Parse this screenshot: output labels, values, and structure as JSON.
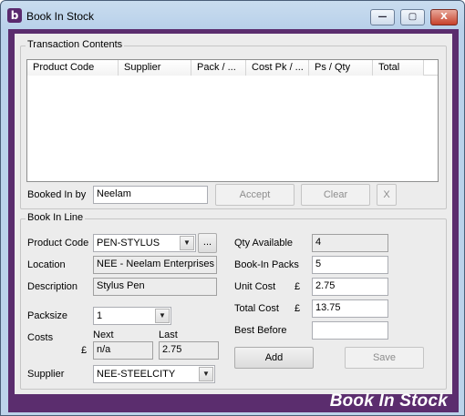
{
  "window": {
    "app_icon": "b",
    "title": "Book In Stock",
    "minimize_glyph": "—",
    "maximize_glyph": "▢",
    "close_glyph": "X"
  },
  "transaction": {
    "group_title": "Transaction Contents",
    "columns": [
      "Product Code",
      "Supplier",
      "Pack / ...",
      "Cost Pk / ...",
      "Ps / Qty",
      "Total"
    ],
    "booked_in_by_label": "Booked In by",
    "booked_in_by_value": "Neelam",
    "accept_label": "Accept",
    "clear_label": "Clear",
    "x_label": "X"
  },
  "bookin": {
    "group_title": "Book In Line",
    "product_code_label": "Product Code",
    "product_code_value": "PEN-STYLUS",
    "browse_label": "...",
    "location_label": "Location",
    "location_value": "NEE - Neelam Enterprises",
    "description_label": "Description",
    "description_value": "Stylus Pen",
    "packsize_label": "Packsize",
    "packsize_value": "1",
    "costs_label": "Costs",
    "next_label": "Next",
    "last_label": "Last",
    "currency_symbol": "£",
    "next_cost": "n/a",
    "last_cost": "2.75",
    "supplier_label": "Supplier",
    "supplier_value": "NEE-STEELCITY",
    "qty_available_label": "Qty Available",
    "qty_available_value": "4",
    "bookin_packs_label": "Book-In Packs",
    "bookin_packs_value": "5",
    "unit_cost_label": "Unit Cost",
    "unit_cost_value": "2.75",
    "total_cost_label": "Total Cost",
    "total_cost_value": "13.75",
    "best_before_label": "Best Before",
    "best_before_value": "",
    "add_label": "Add",
    "save_label": "Save"
  },
  "footer": {
    "brand": "Book In Stock"
  },
  "colors": {
    "frame_purple": "#5b2d6e",
    "panel": "#ececec",
    "title_gradient": "#b9d1ea"
  }
}
